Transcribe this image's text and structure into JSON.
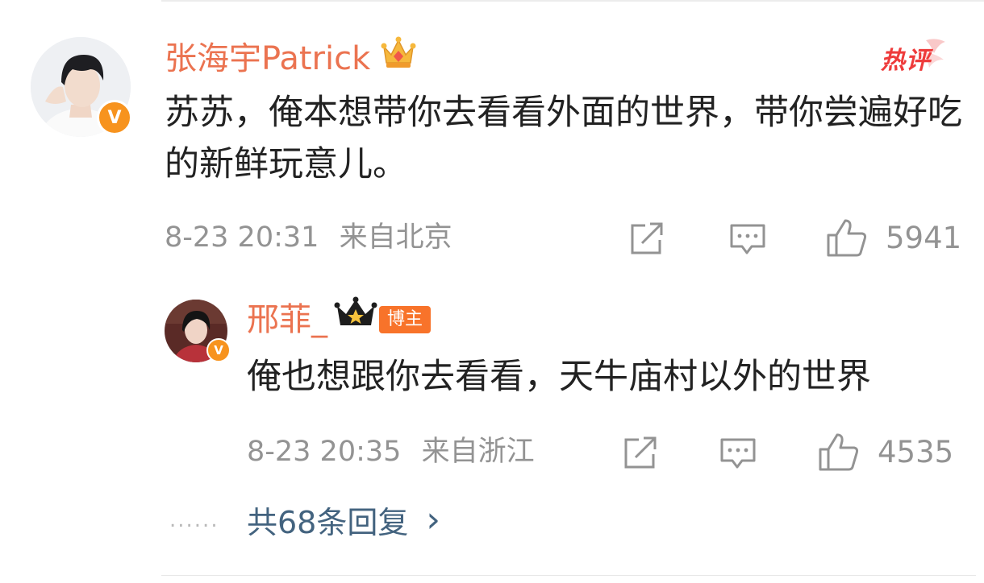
{
  "comment": {
    "author": "张海宇Patrick",
    "verified_mark": "V",
    "badge_icon": "crown-icon",
    "hot_label": "热评",
    "text": "苏苏，俺本想带你去看看外面的世界，带你尝遍好吃的新鲜玩意儿。",
    "time": "8-23 20:31",
    "location": "来自北京",
    "likes": "5941"
  },
  "reply": {
    "author": "邢菲_",
    "verified_mark": "V",
    "badge_icon": "crown-icon",
    "host_label": "博主",
    "text": "俺也想跟你去看看，天牛庙村以外的世界",
    "time": "8-23 20:35",
    "location": "来自浙江",
    "likes": "4535"
  },
  "more": {
    "dots": "......",
    "label": "共68条回复",
    "chevron": "›"
  },
  "colors": {
    "name": "#eb7350",
    "meta": "#939393",
    "link": "#43637f",
    "hot": "#ee3b3b",
    "verified": "#f7931e"
  }
}
